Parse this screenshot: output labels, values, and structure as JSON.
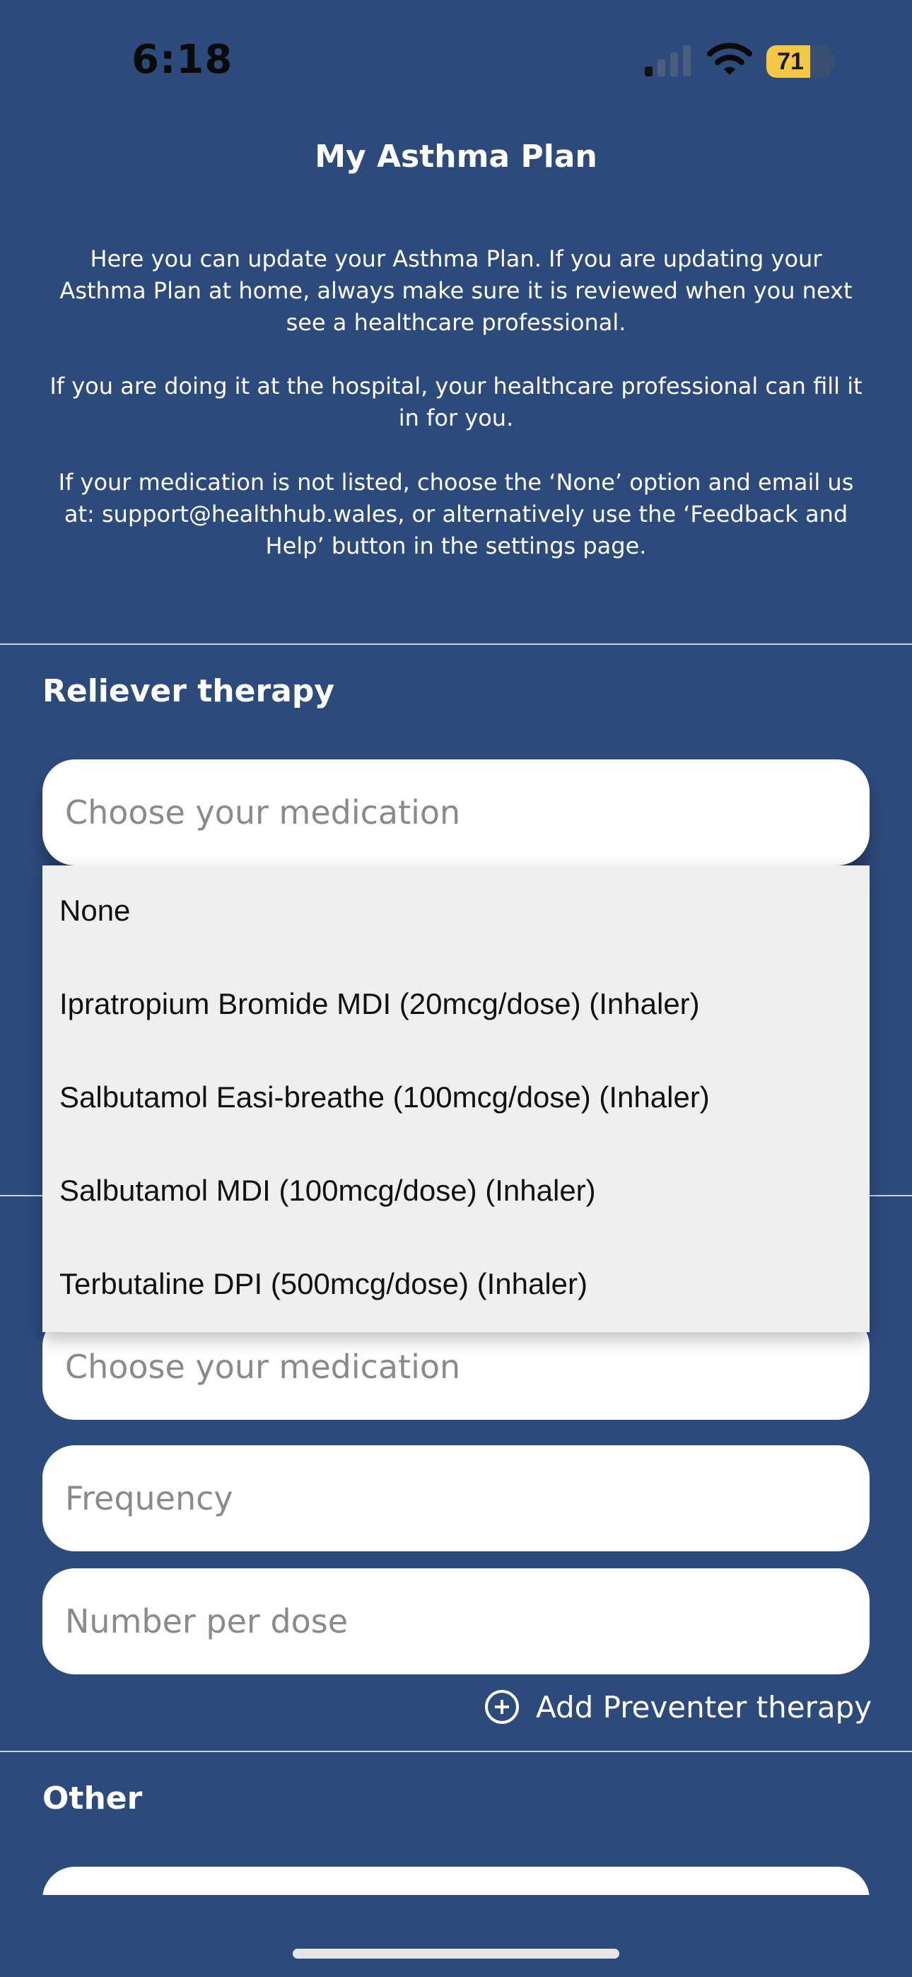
{
  "status_bar": {
    "time": "6:18",
    "battery": "71"
  },
  "page": {
    "title": "My Asthma Plan"
  },
  "intro": {
    "p1": "Here you can update your Asthma Plan. If you are updating your Asthma Plan at home, always make sure it is reviewed when you next see a healthcare professional.",
    "p2": "If you are doing it at the hospital, your healthcare professional can fill it in for you.",
    "p3": "If your medication is not listed, choose the ‘None’ option and email us at: support@healthhub.wales, or alternatively use the ‘Feedback and Help’ button in the settings page."
  },
  "reliever": {
    "heading": "Reliever therapy",
    "medication_placeholder": "Choose your medication",
    "options": [
      "None",
      "Ipratropium Bromide MDI (20mcg/dose) (Inhaler)",
      "Salbutamol Easi-breathe (100mcg/dose) (Inhaler)",
      "Salbutamol MDI (100mcg/dose) (Inhaler)",
      "Terbutaline DPI (500mcg/dose) (Inhaler)"
    ]
  },
  "preventer": {
    "medication_placeholder": "Choose your medication",
    "frequency_placeholder": "Frequency",
    "dose_placeholder": "Number per dose",
    "add_label": "Add Preventer therapy"
  },
  "other": {
    "heading": "Other"
  }
}
